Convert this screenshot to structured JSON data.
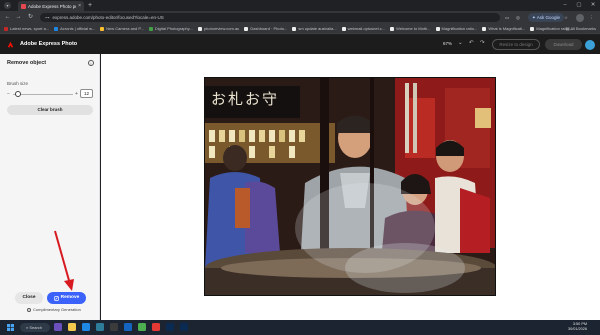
{
  "browser": {
    "tab": {
      "title": "Adobe Express Photo project"
    },
    "address": {
      "url": "express.adobe.com/photo-editor/focused?locale=en-US"
    },
    "ask_google_label": "Ask Google",
    "bookmarks": [
      "Latest news, sport a...",
      "Acronis | official w...",
      "New Camera and P...",
      "Digital Photography...",
      "photoreview.com.au",
      "Dashboard · Photo...",
      "sm update australia...",
      "webmail.optusnet.c...",
      "Welcome to Moth...",
      "Magnification ratio...",
      "What is Magnificati...",
      "Magnification ratio..."
    ],
    "all_bookmarks_label": "All Bookmarks"
  },
  "app": {
    "name": "Adobe Express Photo",
    "zoom": "67%",
    "resize_label": "Resize to design",
    "download_label": "Download"
  },
  "panel": {
    "title": "Remove object",
    "brush_size_label": "Brush size",
    "brush_size_value": "12",
    "brush_size_level": 0.08,
    "clear_brush_label": "Clear brush",
    "close_label": "Close",
    "remove_label": "Remove",
    "complimentary_label": "Complimentary Generation"
  },
  "photo": {
    "sign_text": "お札お守"
  },
  "taskbar": {
    "search_label": "Search",
    "time": "3:50 PM",
    "date": "30/01/2026"
  },
  "colors": {
    "accent": "#3b63fb",
    "annotation_arrow": "#d71920",
    "app_header": "#1c1c1c"
  }
}
